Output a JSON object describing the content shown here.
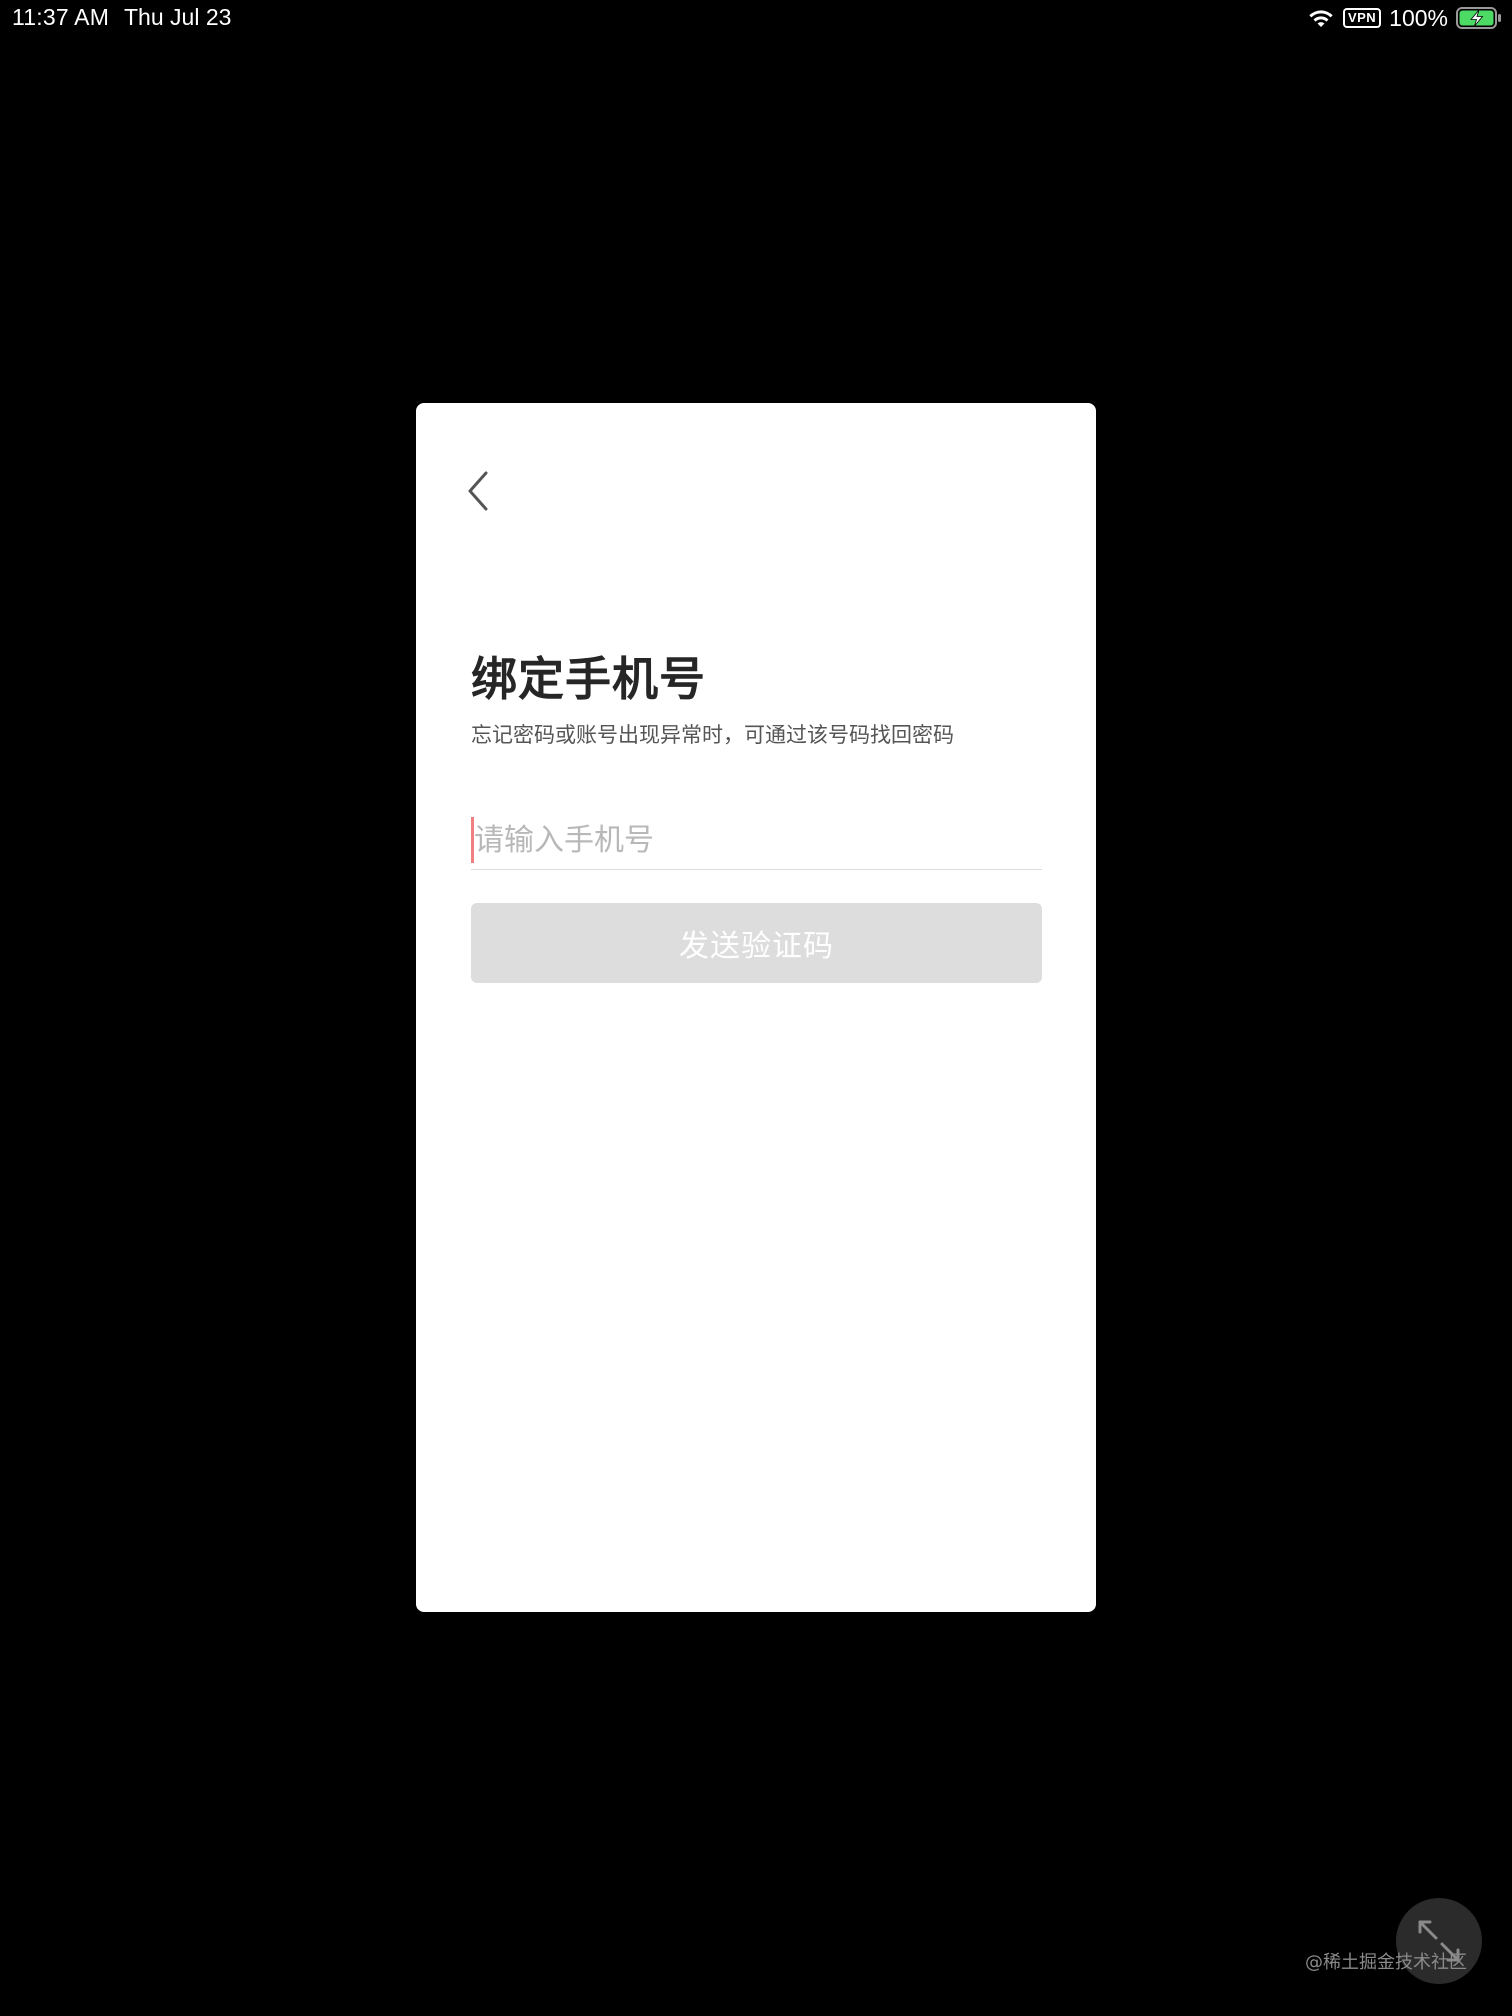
{
  "status_bar": {
    "time": "11:37 AM",
    "date": "Thu Jul 23",
    "vpn": "VPN",
    "battery": "100%",
    "icons": [
      "wifi-icon",
      "battery-charging-icon"
    ]
  },
  "dialog": {
    "back_icon": "chevron-left-icon",
    "title": "绑定手机号",
    "subtitle": "忘记密码或账号出现异常时，可通过该号码找回密码",
    "phone_input": {
      "value": "",
      "placeholder": "请输入手机号"
    },
    "send_code_button": "发送验证码"
  },
  "overlay": {
    "resize_icon": "collapse-arrows-icon",
    "watermark": "@稀土掘金技术社区"
  },
  "colors": {
    "background": "#000000",
    "card": "#ffffff",
    "title": "#262626",
    "button_disabled": "#dddddd",
    "caret": "#f08080",
    "battery_fill": "#4cd964"
  }
}
